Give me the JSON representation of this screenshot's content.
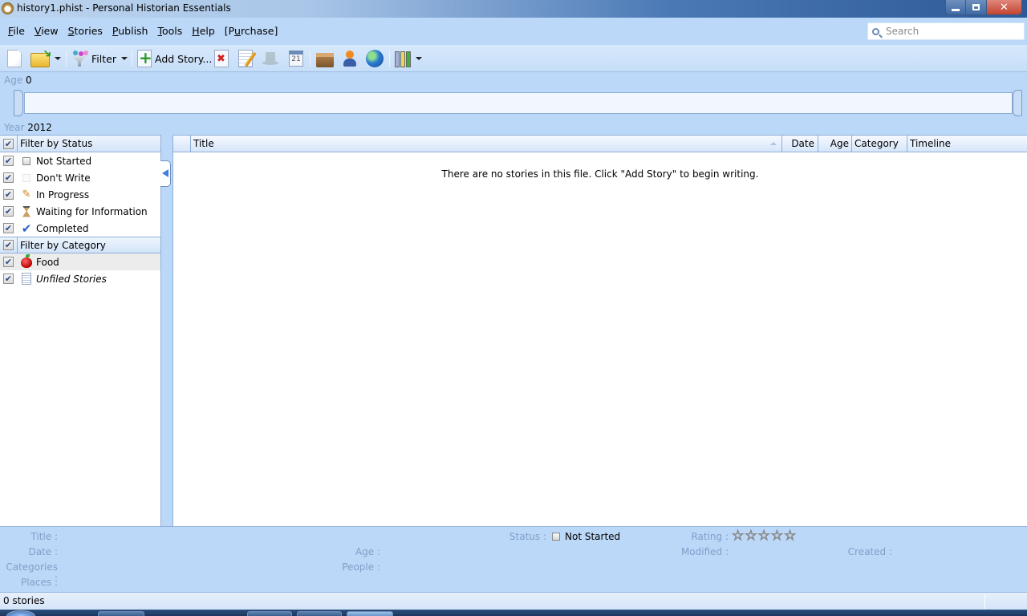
{
  "window": {
    "title": "history1.phist - Personal Historian Essentials",
    "controls": {
      "minimize": "minimize",
      "maximize": "restore",
      "close": "close"
    }
  },
  "menu": {
    "items": [
      {
        "label": "File",
        "mnemonic": "F"
      },
      {
        "label": "View",
        "mnemonic": "V"
      },
      {
        "label": "Stories",
        "mnemonic": "S"
      },
      {
        "label": "Publish",
        "mnemonic": "P"
      },
      {
        "label": "Tools",
        "mnemonic": "T"
      },
      {
        "label": "Help",
        "mnemonic": "H"
      },
      {
        "label": "[Purchase]",
        "mnemonic": "u"
      }
    ]
  },
  "search": {
    "placeholder": "Search",
    "value": ""
  },
  "toolbar": {
    "new": "new-file-icon",
    "open": "open-folder-icon",
    "filter_label": "Filter",
    "add_story_label": "Add Story...",
    "delete": "delete-story-icon",
    "edit": "edit-story-icon",
    "hat": "hat-icon",
    "calendar": "calendar-icon",
    "calendar_day": "21",
    "archive": "box-icon",
    "people": "person-icon",
    "places": "globe-icon",
    "books": "books-icon"
  },
  "timeline": {
    "age_label": "Age",
    "age_value": "0",
    "year_label": "Year",
    "year_value": "2012"
  },
  "sidebar": {
    "status_header": "Filter by Status",
    "status_items": [
      {
        "label": "Not Started",
        "icon": "empty-checkbox-icon",
        "checked": true
      },
      {
        "label": "Don't Write",
        "icon": "faint-box-icon",
        "checked": true
      },
      {
        "label": "In Progress",
        "icon": "pencil-icon",
        "checked": true
      },
      {
        "label": "Waiting for Information",
        "icon": "hourglass-icon",
        "checked": true
      },
      {
        "label": "Completed",
        "icon": "checkmark-icon",
        "checked": true
      }
    ],
    "category_header": "Filter by Category",
    "category_items": [
      {
        "label": "Food",
        "icon": "apple-icon",
        "checked": true
      },
      {
        "label": "Unfiled Stories",
        "icon": "document-icon",
        "checked": true
      }
    ]
  },
  "grid": {
    "columns": [
      "Title",
      "Date",
      "Age",
      "Category",
      "Timeline"
    ],
    "sort_column": "Title",
    "empty_message": "There are no stories in this file.  Click \"Add Story\" to begin writing."
  },
  "details": {
    "title_label": "Title :",
    "date_label": "Date :",
    "categories_label": "Categories :",
    "places_label": "Places :",
    "age_label": "Age :",
    "people_label": "People :",
    "status_label": "Status :",
    "status_value": "Not Started",
    "rating_label": "Rating :",
    "rating_value": 0,
    "rating_max": 5,
    "modified_label": "Modified :",
    "created_label": "Created :"
  },
  "statusbar": {
    "count": "0 stories"
  },
  "colors": {
    "chrome": "#bcd8f8",
    "border": "#8eaed8",
    "muted_label": "#7f9fc9",
    "accent_arrow": "#3d7ee0"
  }
}
